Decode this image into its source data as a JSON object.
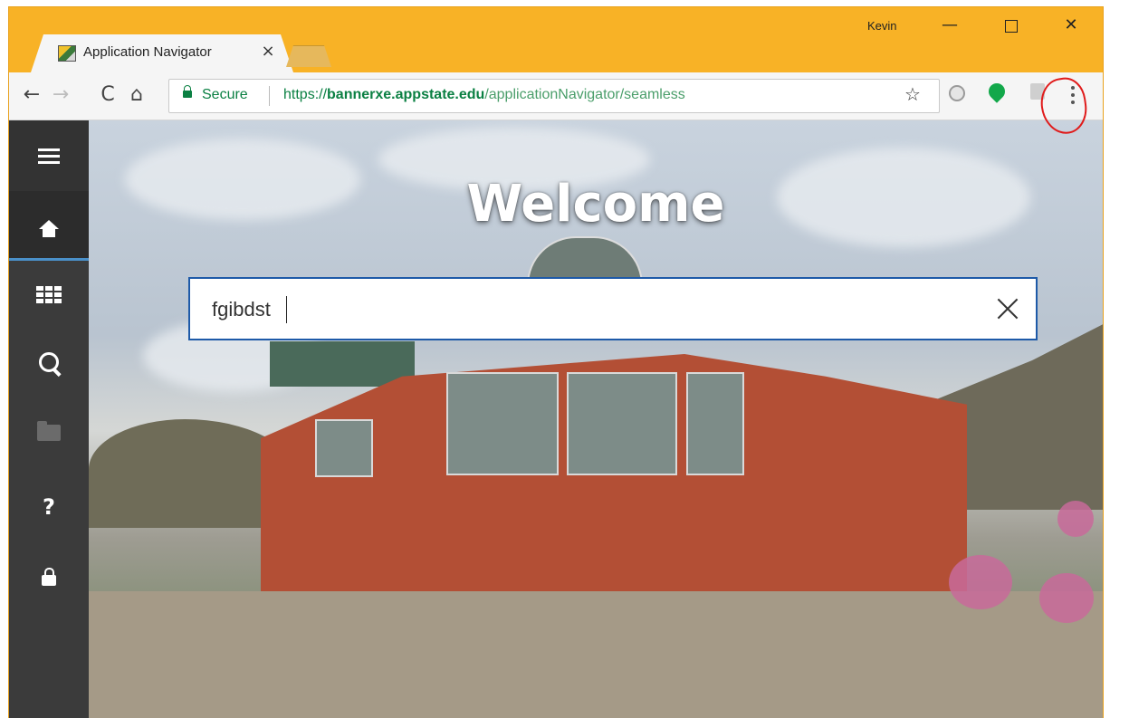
{
  "browser": {
    "tab_title": "Application Navigator",
    "tab_close": "×",
    "user": "Kevin",
    "window_controls": {
      "minimize": "—",
      "close": "✕"
    },
    "nav": {
      "back": "←",
      "forward": "→",
      "reload": "C",
      "home": "⌂"
    },
    "address": {
      "secure_label": "Secure",
      "url_scheme": "https://",
      "url_domain": "bannerxe.appstate.edu",
      "url_path": "/applicationNavigator/seamless"
    },
    "bookmark_star": "☆"
  },
  "sidebar": {
    "items": [
      {
        "name": "menu",
        "icon": "hamburger-icon"
      },
      {
        "name": "home",
        "icon": "home-icon",
        "active": true
      },
      {
        "name": "applications",
        "icon": "grid-icon"
      },
      {
        "name": "search",
        "icon": "search-icon"
      },
      {
        "name": "recent",
        "icon": "folder-icon"
      },
      {
        "name": "help",
        "icon": "help-icon",
        "label": "?"
      },
      {
        "name": "sign-out",
        "icon": "lock-icon"
      }
    ]
  },
  "main": {
    "welcome": "Welcome",
    "search_value": "fgibdst"
  },
  "colors": {
    "chrome_frame": "#f8b226",
    "sidebar_bg": "#3b3b3b",
    "search_border": "#1e5aa8",
    "secure_green": "#0b8043",
    "annotation_red": "#e01b1b"
  }
}
